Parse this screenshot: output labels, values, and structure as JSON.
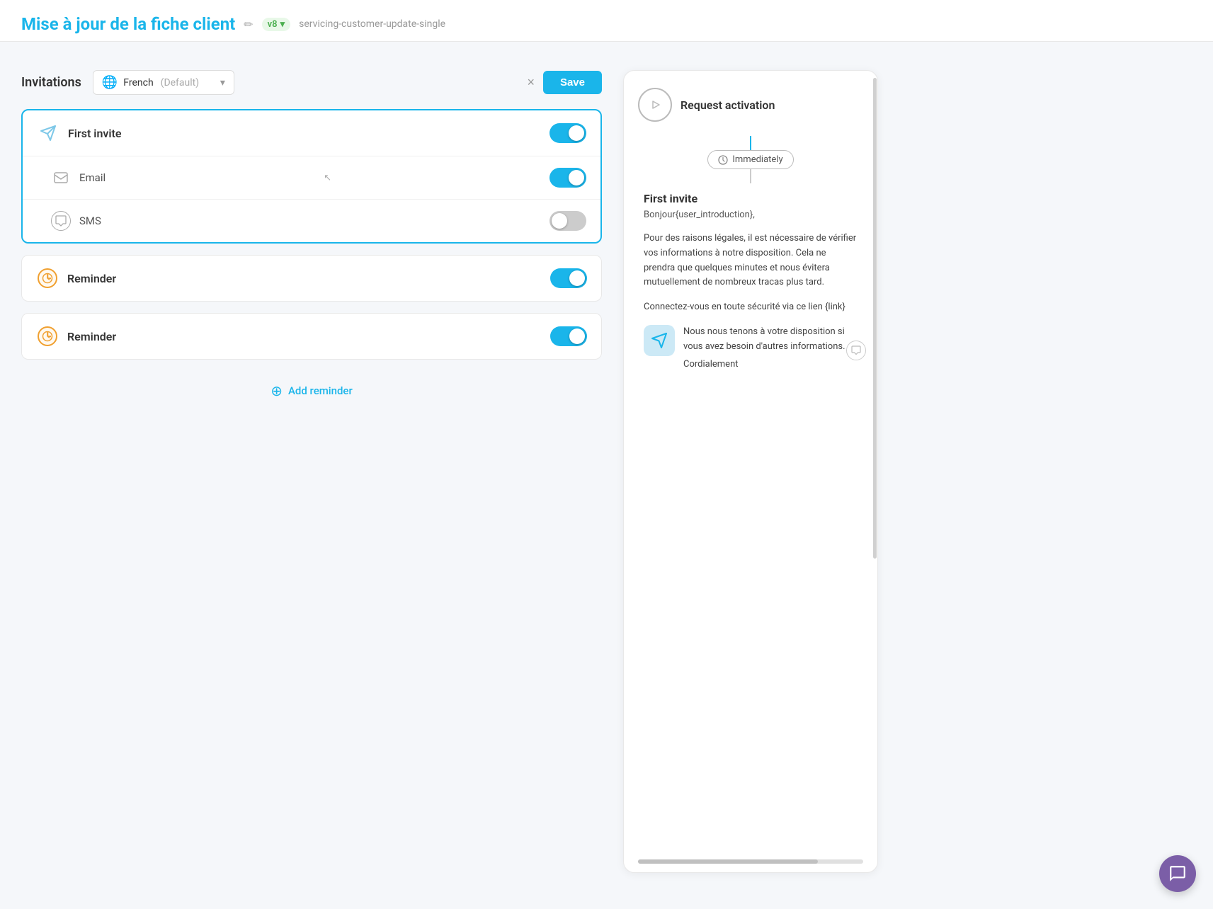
{
  "header": {
    "title": "Mise à jour de la fiche client",
    "edit_icon": "✏",
    "version": "v8",
    "slug": "servicing-customer-update-single"
  },
  "invitations": {
    "label": "Invitations",
    "language": {
      "name": "French",
      "default_label": "(Default)"
    },
    "close_label": "×",
    "save_label": "Save"
  },
  "first_invite": {
    "label": "First invite",
    "toggle": "on",
    "channels": [
      {
        "id": "email",
        "label": "Email",
        "toggle": "on",
        "icon": "email"
      },
      {
        "id": "sms",
        "label": "SMS",
        "toggle": "off",
        "icon": "sms"
      }
    ]
  },
  "reminders": [
    {
      "label": "Reminder",
      "toggle": "on"
    },
    {
      "label": "Reminder",
      "toggle": "on"
    }
  ],
  "add_reminder": {
    "label": "Add reminder"
  },
  "preview": {
    "request_activation_label": "Request activation",
    "immediately_label": "Immediately",
    "first_invite_title": "First invite",
    "first_invite_subtitle": "Bonjour{user_introduction},",
    "body_paragraph_1": "Pour des raisons légales, il est nécessaire de vérifier vos informations à notre disposition. Cela ne prendra que quelques minutes et nous évitera mutuellement de nombreux tracas plus tard.",
    "body_paragraph_2": "Connectez-vous en toute sécurité via ce lien {link}",
    "body_paragraph_3": "Nous nous tenons à votre disposition si vous avez besoin d'autres informations.",
    "body_paragraph_4": "Cordialement"
  }
}
